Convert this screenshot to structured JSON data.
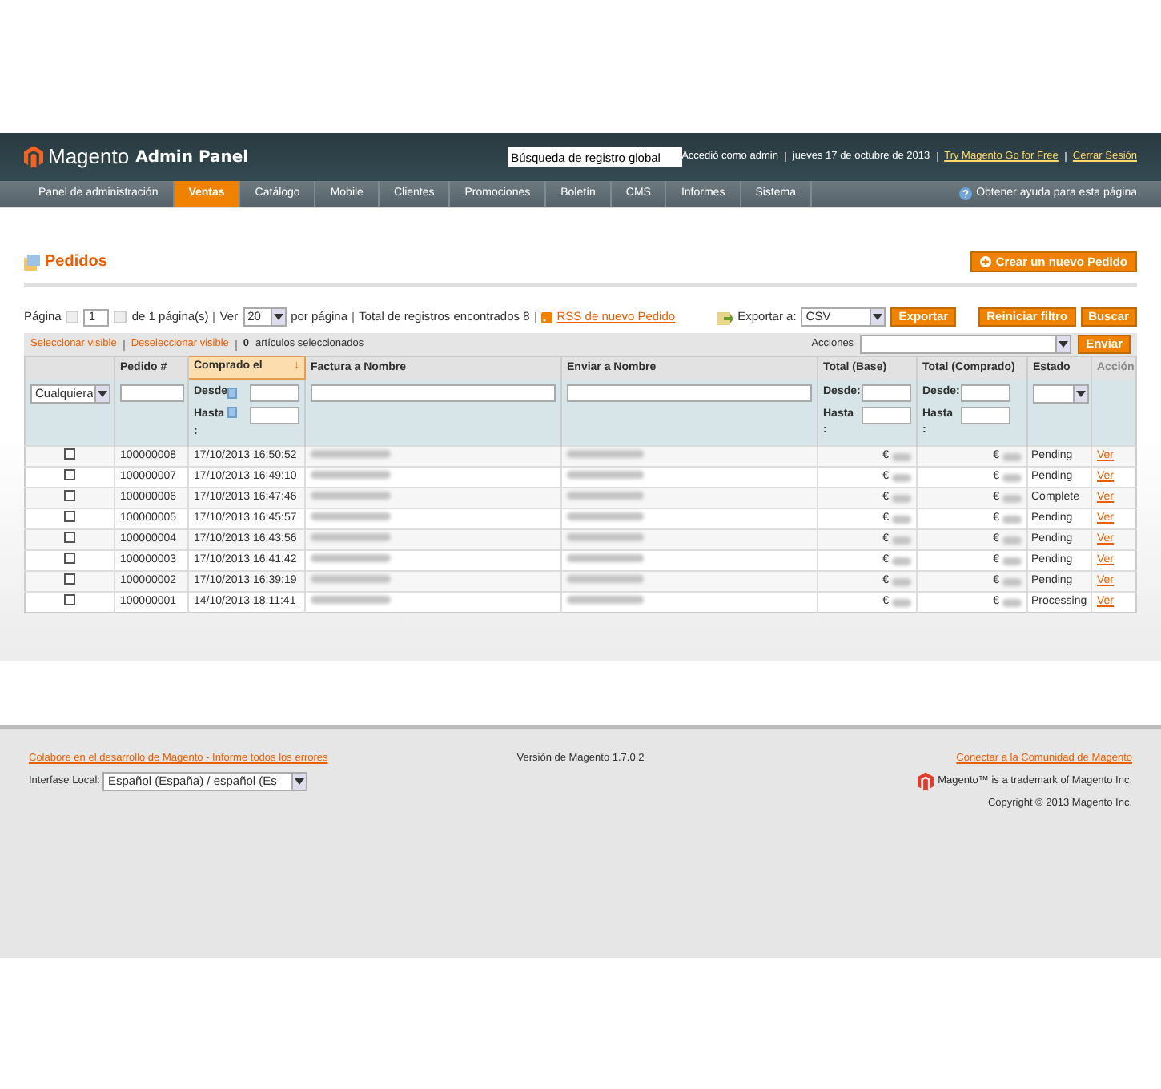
{
  "header": {
    "logo": "Magento",
    "logo_sub": "Admin Panel",
    "search": {
      "value": "Búsqueda de registro global"
    },
    "user_info": "Accedió como admin",
    "date": "jueves 17 de octubre de 2013",
    "links": [
      "Try Magento Go for Free",
      "Cerrar Sesión"
    ]
  },
  "nav": {
    "items": [
      {
        "label": "Panel de administración",
        "selected": false
      },
      {
        "label": "Ventas",
        "selected": true
      },
      {
        "label": "Catálogo",
        "selected": false
      },
      {
        "label": "Mobile",
        "selected": false
      },
      {
        "label": "Clientes",
        "selected": false
      },
      {
        "label": "Promociones",
        "selected": false
      },
      {
        "label": "Boletín",
        "selected": false
      },
      {
        "label": "CMS",
        "selected": false
      },
      {
        "label": "Informes",
        "selected": false
      },
      {
        "label": "Sistema",
        "selected": false
      }
    ],
    "help": "Obtener ayuda para esta página"
  },
  "page": {
    "title": "Pedidos",
    "create_button": "Crear un nuevo Pedido"
  },
  "pager": {
    "page_label": "Página",
    "page_value": "1",
    "of_pages": "de 1 página(s)",
    "view_label": "Ver",
    "per_page": "20",
    "per_page_label": "por página",
    "total": "Total de registros encontrados 8",
    "rss": "RSS de nuevo Pedido",
    "export_label": "Exportar a:",
    "export_format": "CSV",
    "export_button": "Exportar",
    "reset_button": "Reiniciar filtro",
    "search_button": "Buscar"
  },
  "massaction": {
    "select_visible": "Seleccionar visible",
    "deselect_visible": "Deseleccionar visible",
    "selected_count": "0",
    "selected_label": "artículos seleccionados",
    "actions_label": "Acciones",
    "submit": "Enviar"
  },
  "table": {
    "columns": [
      {
        "sorted": false
      },
      {
        "label": "Pedido #",
        "sorted": false
      },
      {
        "label": "Comprado el",
        "sorted": true,
        "sort_arrow": "↓"
      },
      {
        "label": "Factura a Nombre",
        "sorted": false
      },
      {
        "label": "Enviar a Nombre",
        "sorted": false
      },
      {
        "label": "Total (Base)",
        "sorted": false
      },
      {
        "label": "Total (Comprado)",
        "sorted": false
      },
      {
        "label": "Estado",
        "sorted": false
      },
      {
        "label": "Acción",
        "sorted": false
      }
    ],
    "filters": {
      "any": "Cualquiera",
      "from": "Desde",
      "to": "Hasta\n:",
      "totals": [
        {
          "from": "Desde:",
          "to": "Hasta\n:"
        },
        {
          "from": "Desde:",
          "to": "Hasta\n:"
        }
      ]
    },
    "rows": [
      {
        "checked": false,
        "order": "100000008",
        "date": "17/10/2013 16:50:52",
        "currency_base": "€",
        "currency_purchased": "€",
        "status": "Pending",
        "action": "Ver"
      },
      {
        "checked": false,
        "order": "100000007",
        "date": "17/10/2013 16:49:10",
        "currency_base": "€",
        "currency_purchased": "€",
        "status": "Pending",
        "action": "Ver"
      },
      {
        "checked": false,
        "order": "100000006",
        "date": "17/10/2013 16:47:46",
        "currency_base": "€",
        "currency_purchased": "€",
        "status": "Complete",
        "action": "Ver"
      },
      {
        "checked": false,
        "order": "100000005",
        "date": "17/10/2013 16:45:57",
        "currency_base": "€",
        "currency_purchased": "€",
        "status": "Pending",
        "action": "Ver"
      },
      {
        "checked": false,
        "order": "100000004",
        "date": "17/10/2013 16:43:56",
        "currency_base": "€",
        "currency_purchased": "€",
        "status": "Pending",
        "action": "Ver"
      },
      {
        "checked": false,
        "order": "100000003",
        "date": "17/10/2013 16:41:42",
        "currency_base": "€",
        "currency_purchased": "€",
        "status": "Pending",
        "action": "Ver"
      },
      {
        "checked": false,
        "order": "100000002",
        "date": "17/10/2013 16:39:19",
        "currency_base": "€",
        "currency_purchased": "€",
        "status": "Pending",
        "action": "Ver"
      },
      {
        "checked": false,
        "order": "100000001",
        "date": "14/10/2013 18:11:41",
        "currency_base": "€",
        "currency_purchased": "€",
        "status": "Processing",
        "action": "Ver"
      }
    ]
  },
  "footer": {
    "bug_link": "Colabore en el desarrollo de Magento - Informe todos los errores",
    "locale_label": "Interfase Local:",
    "locale_value": "Español (España) / español (Es",
    "version": "Versión de Magento 1.7.0.2",
    "community_link": "Conectar a la Comunidad de Magento",
    "trademark": "Magento™ is a trademark of Magento Inc.",
    "copyright": "Copyright © 2013 Magento Inc."
  }
}
